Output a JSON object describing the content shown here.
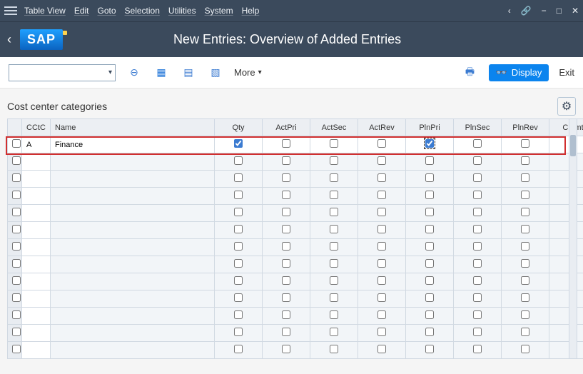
{
  "menu": {
    "items": [
      "Table View",
      "Edit",
      "Goto",
      "Selection",
      "Utilities",
      "System",
      "Help"
    ]
  },
  "titlebar": {
    "logo": "SAP",
    "title": "New Entries: Overview of Added Entries"
  },
  "toolbar": {
    "more": "More",
    "display": "Display",
    "exit": "Exit"
  },
  "section": {
    "title": "Cost center categories"
  },
  "table": {
    "headers": [
      "",
      "CCtC",
      "Name",
      "Qty",
      "ActPri",
      "ActSec",
      "ActRev",
      "PlnPri",
      "PlnSec",
      "PlnRev",
      "Cmmt"
    ],
    "row": {
      "cctc": "A",
      "name": "Finance",
      "qty": true,
      "actpri": false,
      "actsec": false,
      "actrev": false,
      "plnpri": true,
      "plnsec": false,
      "plnrev": false,
      "cmmt": false
    },
    "blank_rows": 12
  }
}
